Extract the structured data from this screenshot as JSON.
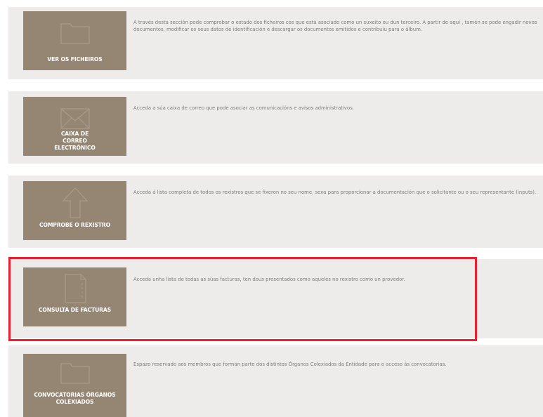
{
  "accent_color": "#958674",
  "highlight_color": "#e8202f",
  "sections": [
    {
      "tile_label": "VER OS FICHEIROS",
      "icon": "folder-icon",
      "description": "A través desta sección pode comprobar o estado dos ficheiros cos que está asociado como un suxeito ou dun terceiro. A partir de aquí , tamén se pode engadir novos documentos, modificar os seus datos de identificación e descargar os documentos emitidos e contribuíu para o álbum."
    },
    {
      "tile_label": "CAIXA DE CORREO ELECTRÓNICO",
      "icon": "envelope-icon",
      "description": "Acceda a súa caixa de correo que pode asociar as comunicacións e avisos administrativos."
    },
    {
      "tile_label": "COMPROBE O REXISTRO",
      "icon": "up-arrow-icon",
      "description": "Acceda á lista completa de todos os rexistros que se fixeron no seu nome, sexa para proporcionar a documentación que o solicitante ou o seu representante (inputs)."
    },
    {
      "tile_label": "CONSULTA DE FACTURAS",
      "icon": "document-icon",
      "description": "Acceda unha lista de todas as súas facturas, ten dous presentados como aqueles no rexistro como un provedor."
    },
    {
      "tile_label": "CONVOCATORIAS ÓRGANOS COLEXIADOS",
      "icon": "folder-icon",
      "description": "Espazo reservado aos membros que forman parte dos distintos Órganos Colexiados da Entidade para o acceso ás convocatorias."
    }
  ]
}
